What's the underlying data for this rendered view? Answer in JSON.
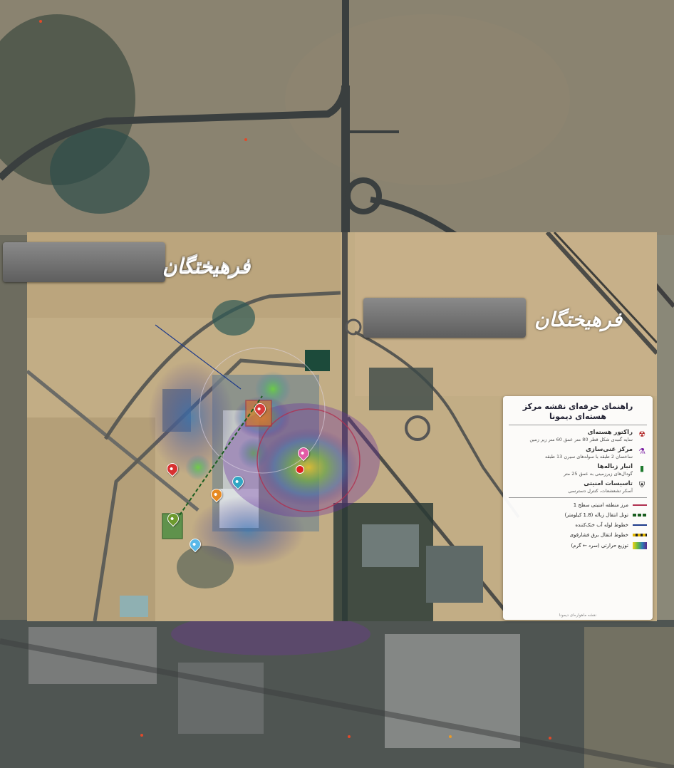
{
  "watermark": "فرهیختگان",
  "legend": {
    "title": "راهنمای حرفه‌ای نقشه مرکز هسته‌ای دیمونا",
    "items": [
      {
        "icon": "radiation-icon",
        "title": "راکتور هسته‌ای",
        "desc": "سایه گنبدی شکل قطر 80 متر عمق 60 متر زیر زمین",
        "color": "#b02020"
      },
      {
        "icon": "flask-icon",
        "title": "مرکز غنی‌سازی",
        "desc": "ساختمان 2 طبقه با سوله‌های سیرن 13 طبقه",
        "color": "#7a1fa2"
      },
      {
        "icon": "storage-icon",
        "title": "انبار زباله‌ها",
        "desc": "گودال‌های زیرزمینی به عمق 25 متر",
        "color": "#1e7a2e"
      },
      {
        "icon": "shield-icon",
        "title": "تاسیسات امنیتی",
        "desc": "آسکر تشعشعات، کنترل دسترسی",
        "color": "#111111"
      }
    ],
    "lines": [
      {
        "label": "مرز منطقه امنیتی سطح 1",
        "color": "#b03050"
      },
      {
        "label": "تونل انتقال زباله (1.8 کیلومتر)",
        "color": "#1b5e20"
      },
      {
        "label": "خطوط لوله آب خنک‌کننده",
        "color": "#1d3a8a"
      },
      {
        "label": "خطوط انتقال برق فشارقوی",
        "color": "#e0b400"
      },
      {
        "label": "توزیع حرارتی (سرد ← گرم)",
        "color": "gradient"
      }
    ],
    "footer": "نقشه ماهواره‌ای دیمونا"
  }
}
